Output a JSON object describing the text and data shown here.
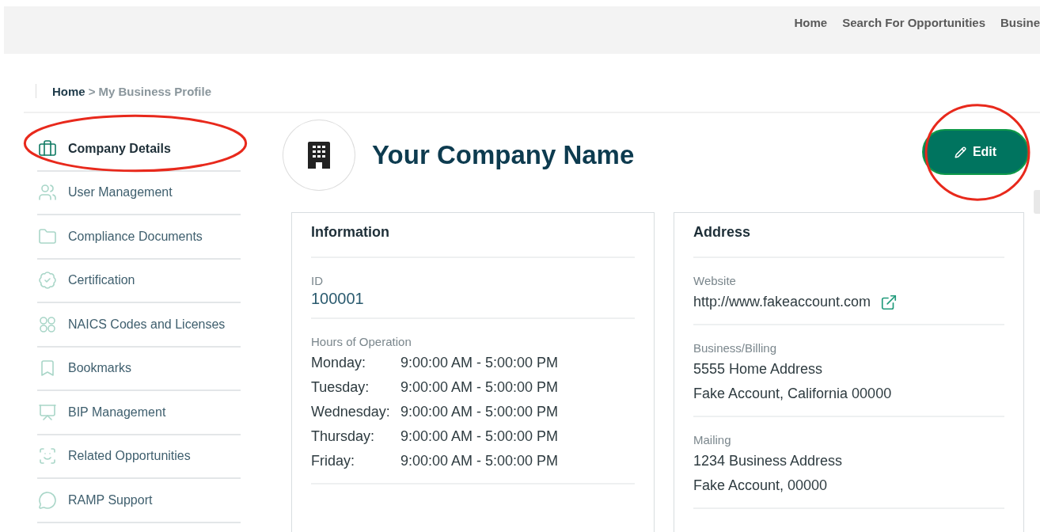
{
  "top_nav": {
    "links": [
      "Home",
      "Search For Opportunities",
      "Busine"
    ]
  },
  "breadcrumb": {
    "home": "Home",
    "separator": ">",
    "current": "My Business Profile"
  },
  "sidebar": {
    "items": [
      {
        "label": "Company Details",
        "selected": true,
        "highlighted": true
      },
      {
        "label": "User Management",
        "selected": false,
        "highlighted": false
      },
      {
        "label": "Compliance Documents",
        "selected": false,
        "highlighted": false
      },
      {
        "label": "Certification",
        "selected": false,
        "highlighted": false
      },
      {
        "label": "NAICS Codes and Licenses",
        "selected": false,
        "highlighted": false
      },
      {
        "label": "Bookmarks",
        "selected": false,
        "highlighted": false
      },
      {
        "label": "BIP Management",
        "selected": false,
        "highlighted": false
      },
      {
        "label": "Related Opportunities",
        "selected": false,
        "highlighted": false
      },
      {
        "label": "RAMP Support",
        "selected": false,
        "highlighted": false
      }
    ]
  },
  "company": {
    "name": "Your Company Name"
  },
  "edit_button": {
    "label": "Edit",
    "highlighted": true
  },
  "information": {
    "title": "Information",
    "id_label": "ID",
    "id_value": "100001",
    "hours_label": "Hours of Operation",
    "hours": [
      {
        "day": "Monday:",
        "time": "9:00:00 AM - 5:00:00 PM"
      },
      {
        "day": "Tuesday:",
        "time": "9:00:00 AM - 5:00:00 PM"
      },
      {
        "day": "Wednesday:",
        "time": "9:00:00 AM - 5:00:00 PM"
      },
      {
        "day": "Thursday:",
        "time": "9:00:00 AM - 5:00:00 PM"
      },
      {
        "day": "Friday:",
        "time": "9:00:00 AM - 5:00:00 PM"
      }
    ]
  },
  "address": {
    "title": "Address",
    "sections": [
      {
        "kind": "link",
        "label": "Website",
        "lines": [
          "http://www.fakeaccount.com"
        ]
      },
      {
        "kind": "text",
        "label": "Business/Billing",
        "lines": [
          "5555 Home Address",
          "Fake Account, California 00000"
        ]
      },
      {
        "kind": "text",
        "label": "Mailing",
        "lines": [
          "1234 Business Address",
          "Fake Account,  00000"
        ]
      }
    ]
  }
}
